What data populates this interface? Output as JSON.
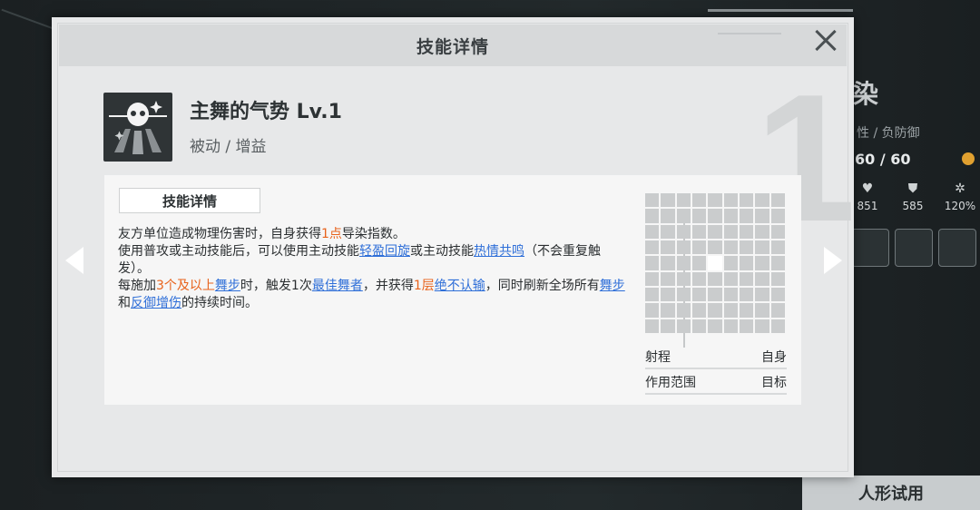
{
  "background": {
    "big_char": "染",
    "stat_label": "性 / 负防御",
    "hp": "60 / 60",
    "stats": [
      {
        "icon": "heart-icon",
        "value": "851"
      },
      {
        "icon": "shield-icon",
        "value": "585"
      },
      {
        "icon": "gear-icon",
        "value": "120%"
      }
    ],
    "trial_button": "人形试用"
  },
  "modal": {
    "title": "技能详情",
    "watermark": "1",
    "skill": {
      "name": "主舞的气势 Lv.1",
      "type": "被动 / 增益",
      "icon": "dancer-skill-icon"
    },
    "detail_tab": "技能详情",
    "description": [
      [
        {
          "t": "友方单位造成物理伤害时，自身获得",
          "s": ""
        },
        {
          "t": "1点",
          "s": "orange"
        },
        {
          "t": "导染指数。",
          "s": ""
        }
      ],
      [
        {
          "t": "使用普攻或主动技能后，可以使用主动技能",
          "s": ""
        },
        {
          "t": "轻盈回旋",
          "s": "blue"
        },
        {
          "t": "或主动技能",
          "s": ""
        },
        {
          "t": "热情共鸣",
          "s": "blue"
        },
        {
          "t": "（不会重复触发）。",
          "s": ""
        }
      ],
      [
        {
          "t": "每施加",
          "s": ""
        },
        {
          "t": "3个及以上",
          "s": "orange"
        },
        {
          "t": "舞步",
          "s": "blue"
        },
        {
          "t": "时，触发1次",
          "s": ""
        },
        {
          "t": "最佳舞者",
          "s": "blue"
        },
        {
          "t": "，并获得",
          "s": ""
        },
        {
          "t": "1层",
          "s": "orange"
        },
        {
          "t": "绝不认输",
          "s": "blue"
        },
        {
          "t": "，同时刷新全场所有",
          "s": ""
        },
        {
          "t": "舞步",
          "s": "blue"
        },
        {
          "t": "和",
          "s": ""
        },
        {
          "t": "反御增伤",
          "s": "blue"
        },
        {
          "t": "的持续时间。",
          "s": ""
        }
      ]
    ],
    "range": {
      "grid_rows": 9,
      "grid_cols": 9,
      "active_cell": [
        5,
        5
      ],
      "rows": [
        {
          "label": "射程",
          "value": "自身"
        },
        {
          "label": "作用范围",
          "value": "目标"
        }
      ]
    }
  },
  "colors": {
    "highlight_orange": "#e8631c",
    "highlight_blue": "#2f6fd8"
  }
}
